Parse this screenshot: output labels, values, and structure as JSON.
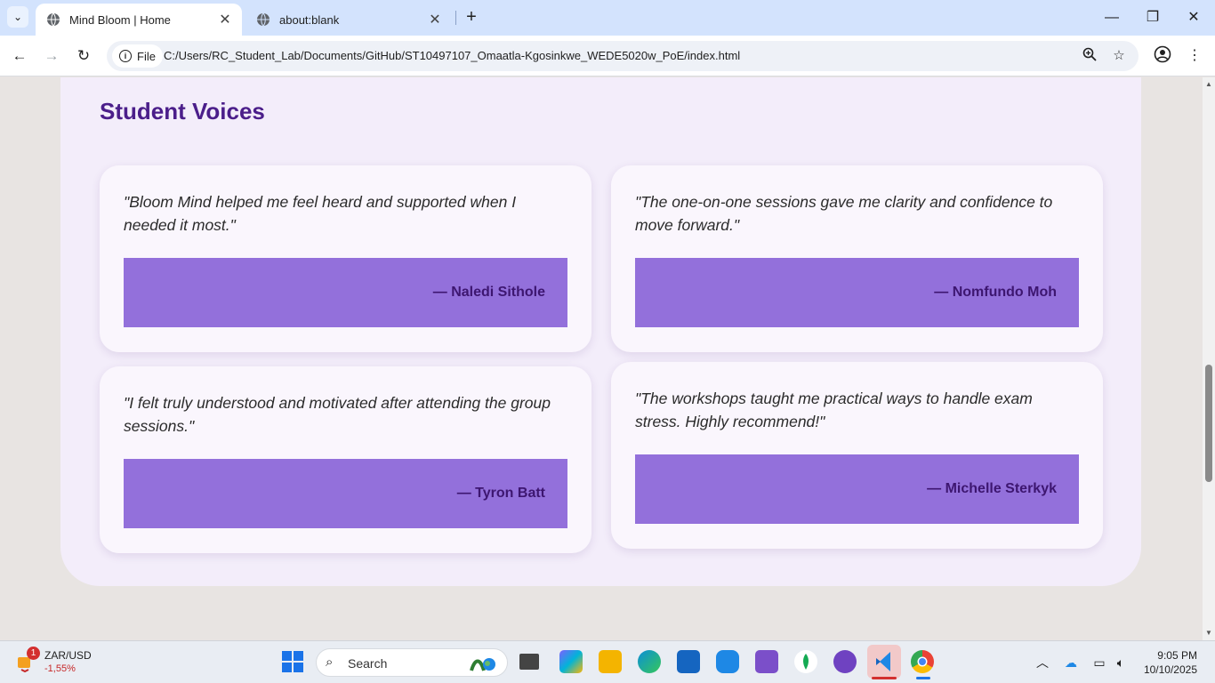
{
  "browser": {
    "tabs": [
      {
        "title": "Mind Bloom | Home",
        "active": true
      },
      {
        "title": "about:blank",
        "active": false
      }
    ],
    "url_scheme_label": "File",
    "url": "C:/Users/RC_Student_Lab/Documents/GitHub/ST10497107_Omaatla-Kgosinkwe_WEDE5020w_PoE/index.html"
  },
  "page": {
    "section_title": "Student Voices",
    "testimonials": [
      {
        "quote": "\"Bloom Mind helped me feel heard and supported when I needed it most.\"",
        "author": "— Naledi Sithole"
      },
      {
        "quote": "\"The one-on-one sessions gave me clarity and confidence to move forward.\"",
        "author": "— Nomfundo Moh"
      },
      {
        "quote": "\"I felt truly understood and motivated after attending the group sessions.\"",
        "author": "— Tyron Batt"
      },
      {
        "quote": "\"The workshops taught me practical ways to handle exam stress. Highly recommend!\"",
        "author": "— Michelle Sterkyk"
      }
    ],
    "colors": {
      "title": "#4b1e8a",
      "panel": "#f3edfa",
      "author_bar": "#9370db",
      "author_text": "#3d1670"
    }
  },
  "taskbar": {
    "ticker_name": "ZAR/USD",
    "ticker_change": "-1,55%",
    "ticker_badge": "1",
    "search_placeholder": "Search",
    "time": "9:05 PM",
    "date": "10/10/2025"
  }
}
